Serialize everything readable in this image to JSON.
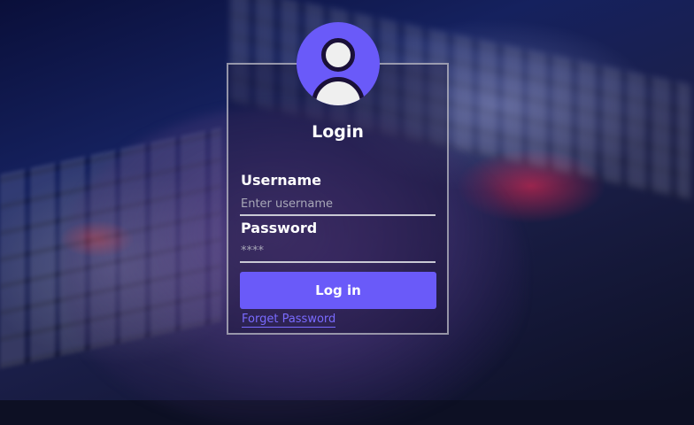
{
  "login": {
    "title": "Login",
    "username_label": "Username",
    "username_placeholder": "Enter username",
    "password_label": "Password",
    "password_placeholder": "****",
    "login_button": "Log in",
    "forgot_link": "Forget Password"
  },
  "icons": {
    "avatar": "user-avatar-icon"
  },
  "colors": {
    "accent": "#6a5af9",
    "link": "#7a6bff",
    "box_border": "#c0c0c8"
  }
}
